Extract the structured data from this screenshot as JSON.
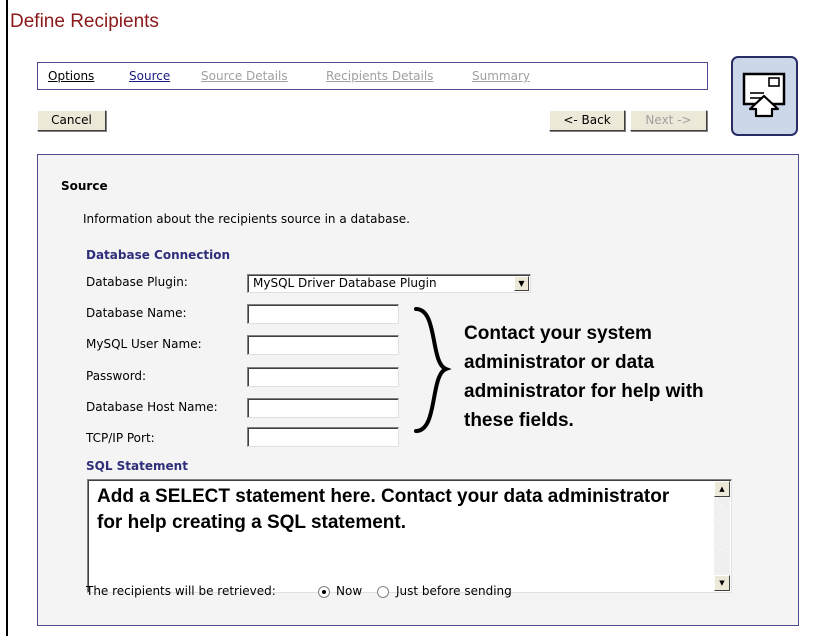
{
  "page": {
    "title": "Define Recipients"
  },
  "tabs": [
    {
      "label": "Options",
      "state": "link"
    },
    {
      "label": "Source",
      "state": "active"
    },
    {
      "label": "Source Details",
      "state": "disabled"
    },
    {
      "label": "Recipients Details",
      "state": "disabled"
    },
    {
      "label": "Summary",
      "state": "disabled"
    }
  ],
  "toolbar": {
    "cancel_label": "Cancel",
    "back_label": "<- Back",
    "next_label": "Next ->"
  },
  "icons": {
    "wizard": "envelope-upload-icon",
    "dropdown": "chevron-down-icon"
  },
  "section": {
    "title": "Source",
    "description": "Information about the recipients source in a database."
  },
  "db": {
    "group_title": "Database Connection",
    "plugin_label": "Database Plugin:",
    "plugin_value": "MySQL Driver Database Plugin",
    "name_label": "Database Name:",
    "user_label": "MySQL User Name:",
    "password_label": "Password:",
    "host_label": "Database Host Name:",
    "port_label": "TCP/IP Port:"
  },
  "callout": "Contact your system administrator or data administrator for help with these fields.",
  "sql": {
    "group_title": "SQL Statement",
    "text": "Add a SELECT statement here. Contact your data administrator for help creating a SQL statement."
  },
  "retrieval": {
    "label": "The recipients will be retrieved:",
    "options": [
      "Now",
      "Just before sending"
    ],
    "selected": "Now"
  },
  "colors": {
    "title": "#8b1a1a",
    "accent": "#2e2e7a",
    "icon_bg": "#ccd7ea"
  }
}
